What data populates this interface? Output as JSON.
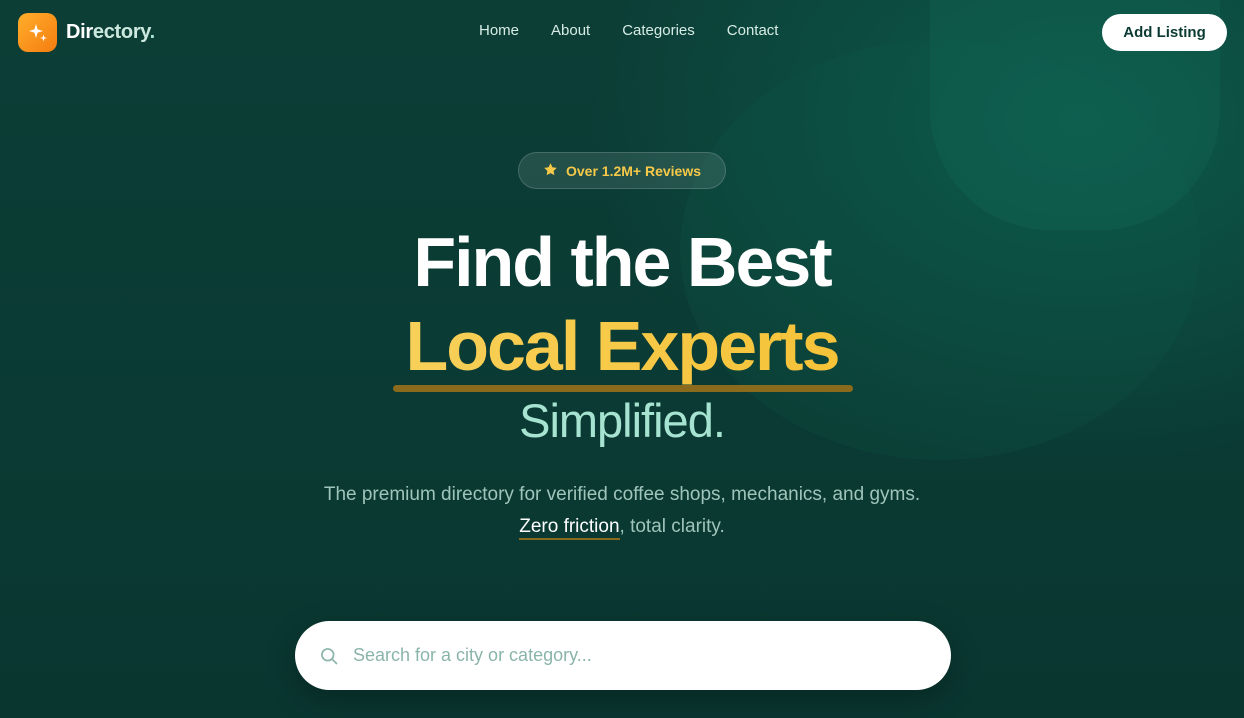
{
  "brand": {
    "name_prefix": "Dir",
    "name_rest": "ectory",
    "name_dot": ".",
    "icon": "sparkle-icon",
    "accent": "#f57d10"
  },
  "nav": {
    "items": [
      {
        "label": "Home"
      },
      {
        "label": "About"
      },
      {
        "label": "Categories"
      },
      {
        "label": "Contact"
      }
    ]
  },
  "header": {
    "cta_label": "Add Listing"
  },
  "hero": {
    "badge_icon": "star-icon",
    "badge_text": "Over 1.2M+ Reviews",
    "title_line1": "Find the Best",
    "title_line2": "Local Experts",
    "title_line3": "Simplified.",
    "subtitle": "The premium directory for verified coffee shops, mechanics, and gyms.",
    "tagline_highlight": "Zero friction",
    "tagline_rest": ", total clarity."
  },
  "search": {
    "icon": "search-icon",
    "placeholder": "Search for a city or category..."
  },
  "colors": {
    "background": "#0b3a33",
    "highlight": "#f7c948",
    "mint": "#a6e3d0"
  }
}
